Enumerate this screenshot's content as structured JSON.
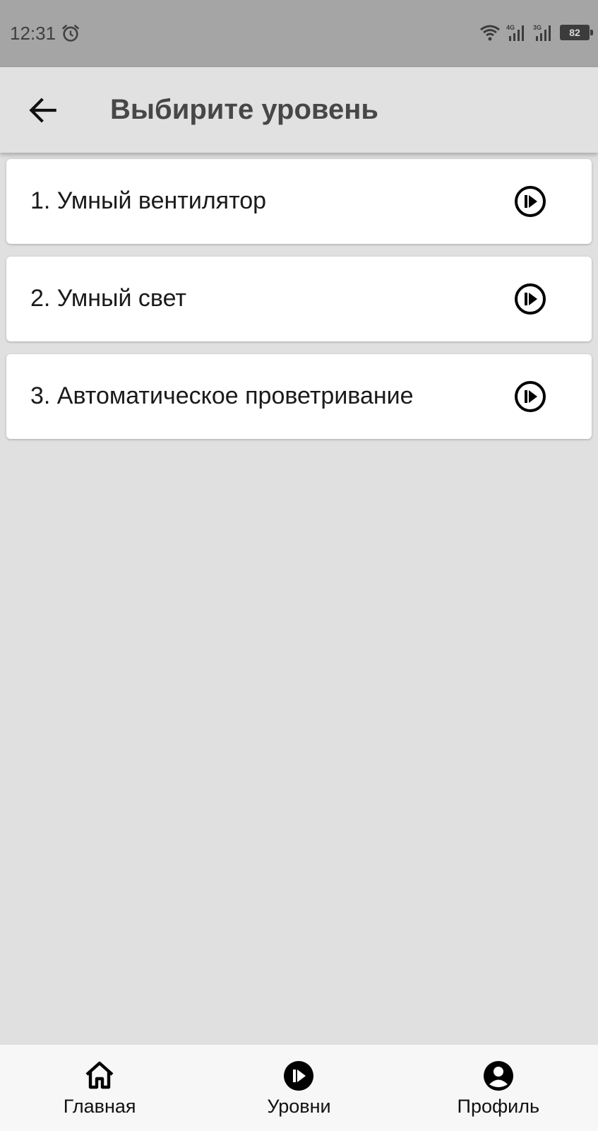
{
  "status_bar": {
    "time": "12:31",
    "battery": "82",
    "network_1": "4G",
    "network_2": "3G"
  },
  "app_bar": {
    "title": "Выбирите уровень"
  },
  "levels": [
    {
      "label": "1. Умный вентилятор",
      "icon": "play-circle-icon"
    },
    {
      "label": "2. Умный свет",
      "icon": "play-circle-icon"
    },
    {
      "label": "3. Автоматическое проветривание",
      "icon": "play-circle-icon"
    }
  ],
  "bottom_nav": {
    "items": [
      {
        "label": "Главная",
        "icon": "home-icon"
      },
      {
        "label": "Уровни",
        "icon": "play-circle-filled-icon"
      },
      {
        "label": "Профиль",
        "icon": "account-circle-icon"
      }
    ]
  }
}
